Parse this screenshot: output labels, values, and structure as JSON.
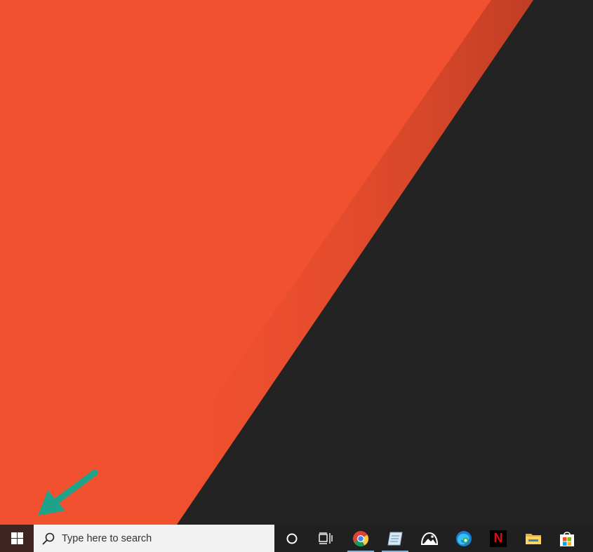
{
  "desktop": {
    "wallpaper_orange": "#f1512f",
    "wallpaper_dark": "#232323",
    "annotation_arrow_color": "#1ea38a"
  },
  "taskbar": {
    "background": "#202020",
    "start_button": {
      "icon": "windows-logo-icon"
    },
    "search": {
      "placeholder": "Type here to search",
      "icon": "search-icon"
    },
    "pinned_apps": [
      {
        "name": "Cortana",
        "icon": "cortana-circle-icon",
        "running": false
      },
      {
        "name": "Task View",
        "icon": "task-view-icon",
        "running": false
      },
      {
        "name": "Google Chrome",
        "icon": "chrome-icon",
        "running": true
      },
      {
        "name": "Notepad-like app",
        "icon": "notepad-app-icon",
        "running": true
      },
      {
        "name": "Photos app",
        "icon": "photos-app-icon",
        "running": false
      },
      {
        "name": "Microsoft Edge",
        "icon": "edge-icon",
        "running": false
      },
      {
        "name": "Netflix",
        "icon": "netflix-icon",
        "running": false
      },
      {
        "name": "File Explorer",
        "icon": "file-explorer-icon",
        "running": false
      },
      {
        "name": "Microsoft Store",
        "icon": "store-icon",
        "running": false
      }
    ],
    "running_indicator_color": "#76b9ed",
    "netflix_letter": "N"
  }
}
